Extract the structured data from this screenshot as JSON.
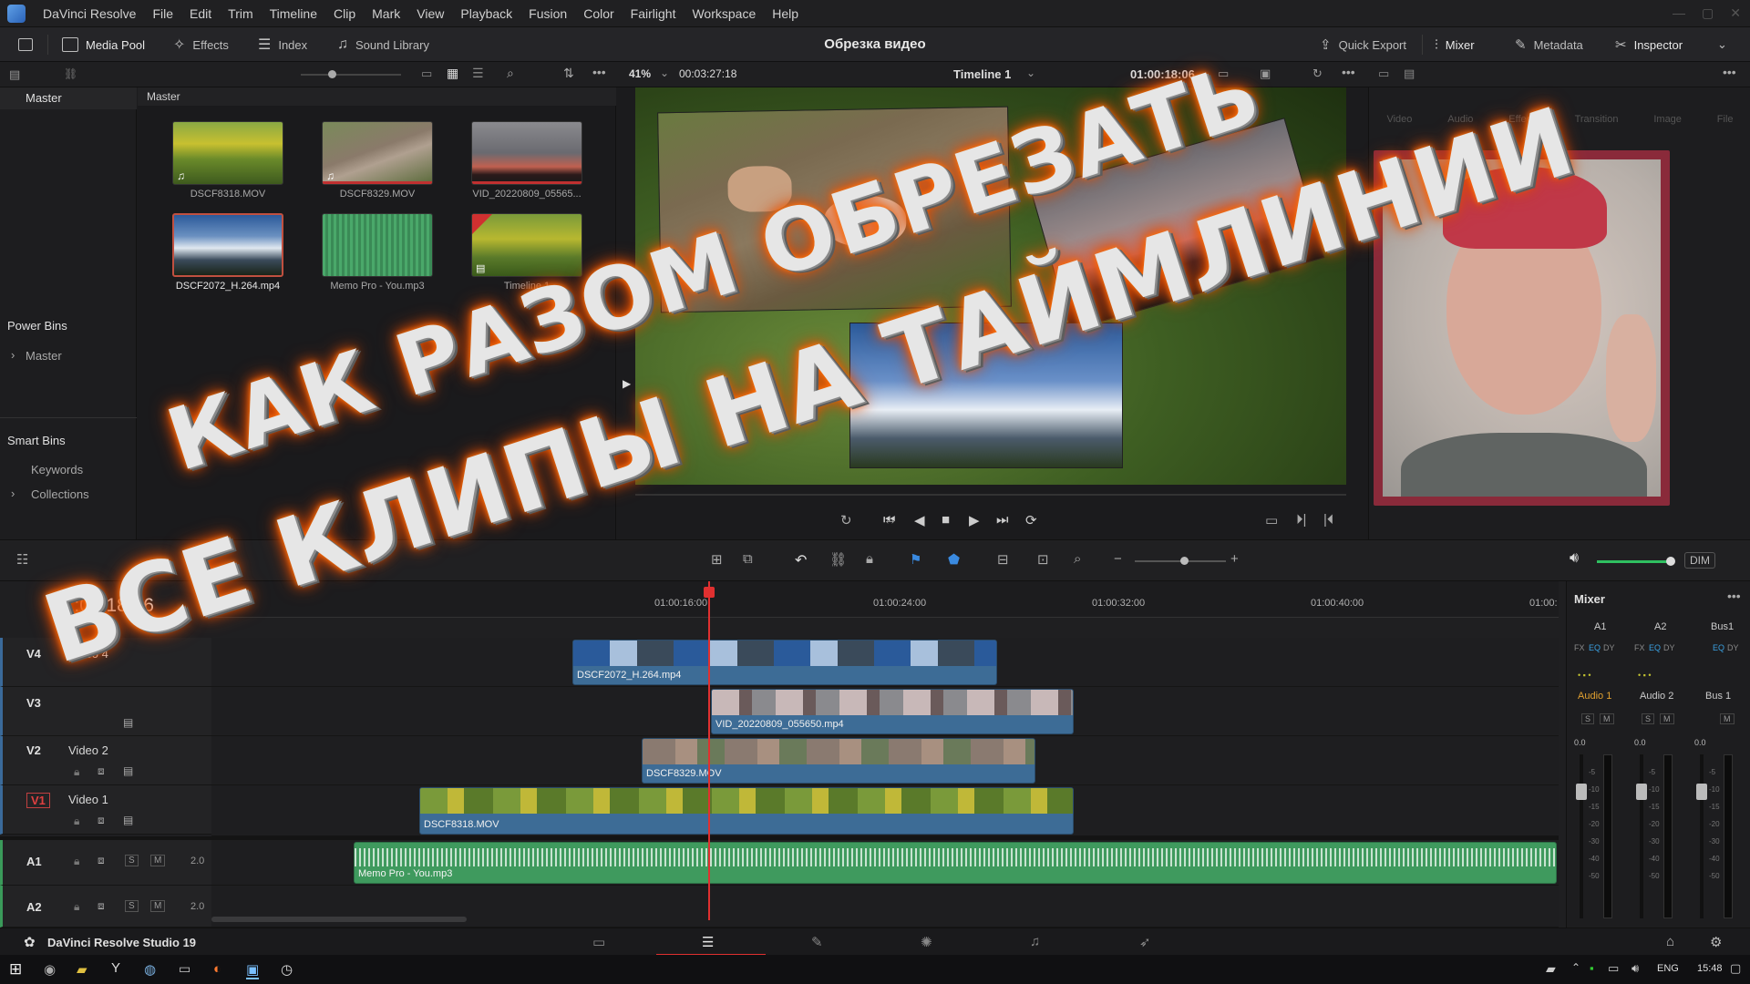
{
  "menubar": {
    "app": "DaVinci Resolve",
    "menus": [
      "File",
      "Edit",
      "Trim",
      "Timeline",
      "Clip",
      "Mark",
      "View",
      "Playback",
      "Fusion",
      "Color",
      "Fairlight",
      "Workspace",
      "Help"
    ]
  },
  "toolbar": {
    "media_pool": "Media Pool",
    "effects": "Effects",
    "index": "Index",
    "sound_library": "Sound Library",
    "title": "Обрезка видео",
    "quick_export": "Quick Export",
    "mixer": "Mixer",
    "metadata": "Metadata",
    "inspector": "Inspector"
  },
  "viewer": {
    "zoom": "41%",
    "duration": "00:03:27:18",
    "timeline_name": "Timeline 1",
    "timecode": "01:00:18:06"
  },
  "bins": {
    "master_header": "Master",
    "power_bins": "Power Bins",
    "power_master": "Master",
    "smart_bins": "Smart Bins",
    "keywords": "Keywords",
    "collections": "Collections"
  },
  "media_pool": {
    "header": "Master",
    "clips": [
      {
        "name": "DSCF8318.MOV"
      },
      {
        "name": "DSCF8329.MOV"
      },
      {
        "name": "VID_20220809_05565..."
      },
      {
        "name": "DSCF2072_H.264.mp4"
      },
      {
        "name": "Memo Pro - You.mp3"
      },
      {
        "name": "Timeline 1"
      }
    ]
  },
  "inspector": {
    "tabs": [
      "Video",
      "Audio",
      "Effects",
      "Transition",
      "Image",
      "File"
    ]
  },
  "timeline": {
    "timecode": "01:00:18:06",
    "ruler": [
      "01:00:0",
      "01:00:16:00",
      "01:00:24:00",
      "01:00:32:00",
      "01:00:40:00",
      "01:00:"
    ],
    "tracks": [
      {
        "id": "V4",
        "name": "Video 4"
      },
      {
        "id": "V3",
        "name": ""
      },
      {
        "id": "V2",
        "name": "Video 2"
      },
      {
        "id": "V1",
        "name": "Video 1"
      },
      {
        "id": "A1",
        "name": "",
        "level": "2.0"
      },
      {
        "id": "A2",
        "name": "",
        "level": "2.0"
      }
    ],
    "clips": {
      "v4": "DSCF2072_H.264.mp4",
      "v3": "VID_20220809_055650.mp4",
      "v2": "DSCF8329.MOV",
      "v1": "DSCF8318.MOV",
      "a1": "Memo Pro - You.mp3"
    },
    "dim": "DIM"
  },
  "mixer": {
    "title": "Mixer",
    "channels": [
      "A1",
      "A2",
      "Bus1"
    ],
    "names": [
      "Audio 1",
      "Audio 2",
      "Bus 1"
    ],
    "values": [
      "0.0",
      "0.0",
      "0.0"
    ],
    "fx": "FX",
    "eq": "EQ",
    "dy": "DY",
    "s": "S",
    "m": "M",
    "scale": [
      "-5",
      "-10",
      "-15",
      "-20",
      "-30",
      "-40",
      "-50"
    ]
  },
  "pages": {
    "product": "DaVinci Resolve Studio 19"
  },
  "taskbar": {
    "lang": "ENG",
    "time": "15:48"
  },
  "overlay": {
    "line1": "КАК РАЗОМ ОБРЕЗАТЬ",
    "line2": "ВСЕ КЛИПЫ НА ТАЙМЛИНИИ"
  }
}
